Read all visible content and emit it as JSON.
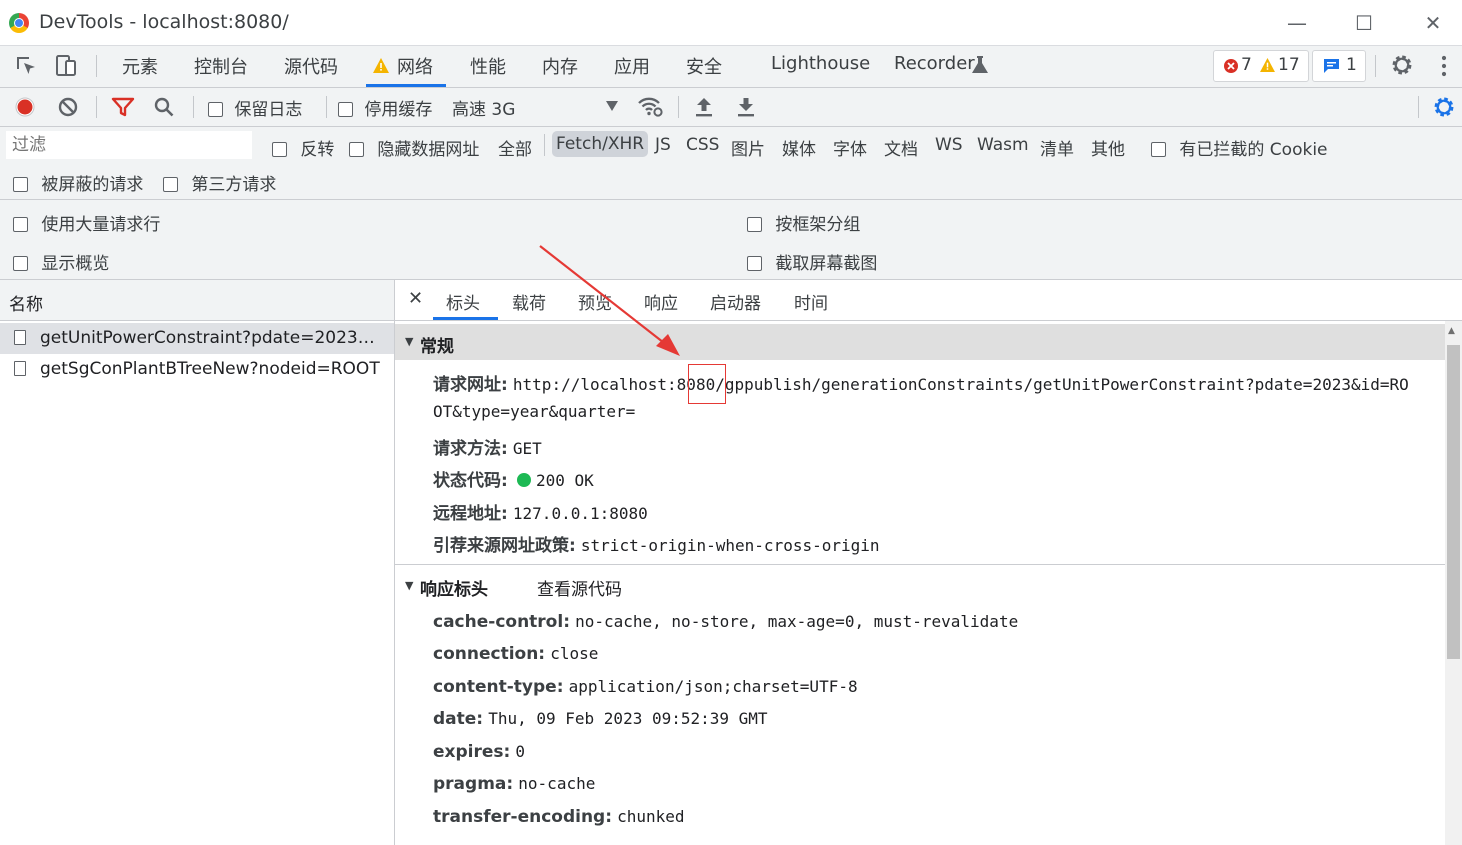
{
  "window": {
    "title": "DevTools - localhost:8080/",
    "minimize": "—",
    "maximize": "☐",
    "close": "✕"
  },
  "main_tabs": [
    "元素",
    "控制台",
    "源代码",
    "网络",
    "性能",
    "内存",
    "应用",
    "安全",
    "Lighthouse",
    "Recorder"
  ],
  "active_main_tab": "网络",
  "badges": {
    "errors": "7",
    "warnings": "17",
    "messages": "1"
  },
  "toolbar": {
    "preserve_log": "保留日志",
    "disable_cache": "停用缓存",
    "throttling": "高速 3G"
  },
  "filter": {
    "placeholder": "过滤",
    "invert": "反转",
    "hide_data_urls": "隐藏数据网址",
    "types": [
      "全部",
      "Fetch/XHR",
      "JS",
      "CSS",
      "图片",
      "媒体",
      "字体",
      "文档",
      "WS",
      "Wasm",
      "清单",
      "其他"
    ],
    "active_type": "Fetch/XHR",
    "blocked_cookies": "有已拦截的 Cookie",
    "blocked_requests": "被屏蔽的请求",
    "third_party": "第三方请求"
  },
  "settings": {
    "big_request_rows": "使用大量请求行",
    "group_by_frame": "按框架分组",
    "show_overview": "显示概览",
    "capture_screenshots": "截取屏幕截图"
  },
  "request_list": {
    "header": "名称",
    "rows": [
      "getUnitPowerConstraint?pdate=2023&id...",
      "getSgConPlantBTreeNew?nodeid=ROOT"
    ]
  },
  "detail_tabs": [
    "标头",
    "载荷",
    "预览",
    "响应",
    "启动器",
    "时间"
  ],
  "active_detail_tab": "标头",
  "general": {
    "title": "常规",
    "request_url_key": "请求网址:",
    "request_url_pre": "http://localhost:",
    "request_url_port": "8080",
    "request_url_post": "/gppublish/generationConstraints/getUnitPowerConstraint?pdate=2023&id=RO",
    "request_url_wrap": "OT&type=year&quarter=",
    "method_key": "请求方法:",
    "method_val": "GET",
    "status_key": "状态代码:",
    "status_val": "200 OK",
    "status_color": "#1db954",
    "remote_key": "远程地址:",
    "remote_val": "127.0.0.1:8080",
    "referrer_key": "引荐来源网址政策:",
    "referrer_val": "strict-origin-when-cross-origin"
  },
  "response_headers": {
    "title": "响应标头",
    "view_source": "查看源代码",
    "rows": [
      {
        "key": "cache-control:",
        "val": "no-cache, no-store, max-age=0, must-revalidate"
      },
      {
        "key": "connection:",
        "val": "close"
      },
      {
        "key": "content-type:",
        "val": "application/json;charset=UTF-8"
      },
      {
        "key": "date:",
        "val": "Thu, 09 Feb 2023 09:52:39 GMT"
      },
      {
        "key": "expires:",
        "val": "0"
      },
      {
        "key": "pragma:",
        "val": "no-cache"
      },
      {
        "key": "transfer-encoding:",
        "val": "chunked"
      }
    ]
  },
  "annotation_color": "#e53935"
}
